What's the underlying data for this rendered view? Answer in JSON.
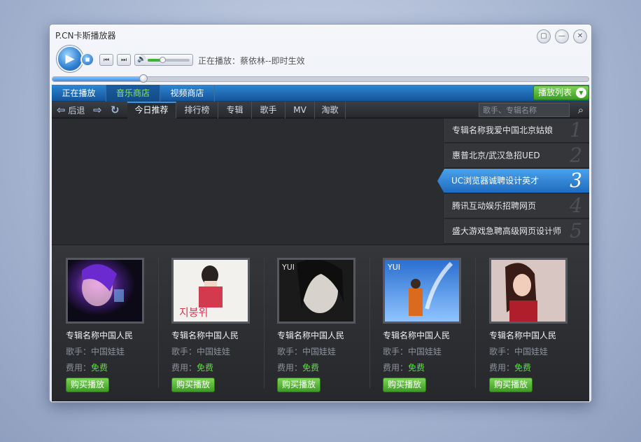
{
  "window": {
    "title": "P.CN卡斯播放器"
  },
  "player": {
    "now_playing": "正在播放：蔡依林--即时生效",
    "volume": 0.35,
    "progress": 0.17
  },
  "tabs": [
    {
      "label": "正在播放",
      "active": false
    },
    {
      "label": "音乐商店",
      "active": true
    },
    {
      "label": "视频商店",
      "active": false
    }
  ],
  "playlist_button": "播放列表",
  "nav": {
    "back": "后退"
  },
  "subtabs": [
    {
      "label": "今日推荐",
      "active": true
    },
    {
      "label": "排行榜",
      "active": false
    },
    {
      "label": "专辑",
      "active": false
    },
    {
      "label": "歌手",
      "active": false
    },
    {
      "label": "MV",
      "active": false
    },
    {
      "label": "淘歌",
      "active": false
    }
  ],
  "search": {
    "placeholder": "歌手、专辑名称"
  },
  "banner": [
    {
      "title": "专辑名称我爱中国北京姑娘",
      "num": "1",
      "active": false
    },
    {
      "title": "惠普北京/武汉急招UED",
      "num": "2",
      "active": false
    },
    {
      "title": "UC浏览器诚聘设计英才",
      "num": "3",
      "active": true
    },
    {
      "title": "腾讯互动娱乐招聘网页",
      "num": "4",
      "active": false
    },
    {
      "title": "盛大游戏急聘高级网页设计师",
      "num": "5",
      "active": false
    }
  ],
  "albums": [
    {
      "name": "专辑名称中国人民",
      "artist": "歌手：中国娃娃",
      "fee_label": "费用：",
      "fee_value": "免费",
      "buy": "购买播放"
    },
    {
      "name": "专辑名称中国人民",
      "artist": "歌手：中国娃娃",
      "fee_label": "费用：",
      "fee_value": "免费",
      "buy": "购买播放"
    },
    {
      "name": "专辑名称中国人民",
      "artist": "歌手：中国娃娃",
      "fee_label": "费用：",
      "fee_value": "免费",
      "buy": "购买播放"
    },
    {
      "name": "专辑名称中国人民",
      "artist": "歌手：中国娃娃",
      "fee_label": "费用：",
      "fee_value": "免费",
      "buy": "购买播放"
    },
    {
      "name": "专辑名称中国人民",
      "artist": "歌手：中国娃娃",
      "fee_label": "费用：",
      "fee_value": "免费",
      "buy": "购买播放"
    }
  ],
  "colors": {
    "accent": "#2f86d0",
    "green": "#3b9c22",
    "free": "#5ede3f"
  },
  "icons": [
    "play-icon",
    "stop-icon",
    "prev-icon",
    "next-icon",
    "volume-icon",
    "minimize-icon",
    "maximize-icon",
    "close-icon",
    "chevron-down-icon",
    "back-arrow-icon",
    "forward-arrow-icon",
    "refresh-icon",
    "search-icon"
  ]
}
